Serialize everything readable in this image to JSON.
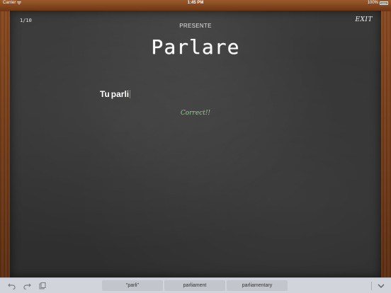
{
  "status_bar": {
    "carrier": "Carrier",
    "time": "1:45 PM",
    "battery": "100%"
  },
  "board": {
    "progress": "1/10",
    "exit_label": "EXIT",
    "tense": "PRESENTE",
    "verb": "Parlare",
    "pronoun": "Tu",
    "answer": "parli",
    "feedback": "Correct!!"
  },
  "keyboard_bar": {
    "suggestions": [
      "\"parli\"",
      "parliament",
      "parliamentary"
    ]
  },
  "colors": {
    "board": "#333333",
    "frame": "#6b3b1c",
    "feedback": "#8fcf8a",
    "caret": "#4a8cff"
  },
  "icons": [
    "wifi-icon",
    "battery-icon",
    "undo-icon",
    "redo-icon",
    "paste-icon",
    "chevron-down-icon"
  ]
}
